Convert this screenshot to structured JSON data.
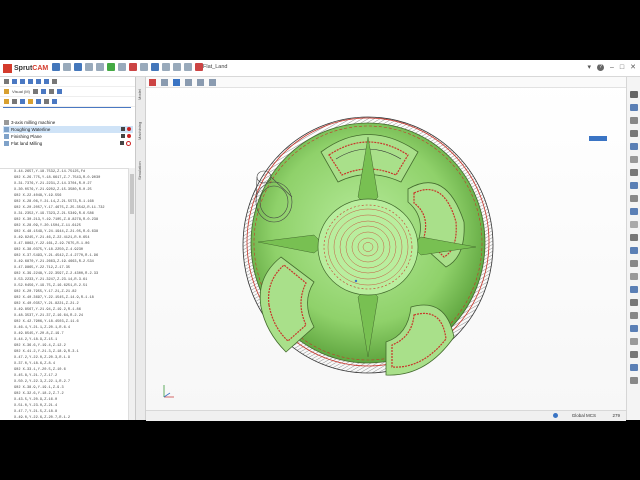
{
  "app": {
    "name_part1": "Sprut",
    "name_part2": "CAM",
    "document_title": "Flat_Land"
  },
  "left_panel": {
    "machine_select": "Visual (M)",
    "tree": [
      {
        "label": "3-axis milling machine",
        "selected": false,
        "checked": false,
        "status": "none"
      },
      {
        "label": "Roughing Waterline",
        "selected": true,
        "checked": true,
        "status": "filled"
      },
      {
        "label": "Finishing Plane",
        "selected": false,
        "checked": true,
        "status": "filled"
      },
      {
        "label": "Flat land Milling",
        "selected": false,
        "checked": true,
        "status": "hollow"
      }
    ],
    "code_lines": [
      "X-44.2657,Y-18.7532,Z-14.75125,Fd",
      "G02 X-26.775,Y-18.6617,Z-7.7543,R-0.9030",
      "X-31.7376,Y-21.2231,Z-14.3704,R-0.27",
      "X-30.0576,Y-21.9202,Z-15.3580,R-0.25",
      "G02 X-22.4048,Y-19.556",
      "G02 X-28.06,Y-21.14,Z-21.5573,R-1.168",
      "G02 X-20.2057,Y-17.4675,Z-25.3542,R-11.732",
      "X-31.2352,Y-19.7323,Z-21.5349,R-6.586",
      "G02 X-30.213,Y-19.7105,Z-8.8278,R-0.238",
      "G02 X-28.09,Y-20.1504,Z-11.6125",
      "G02 X-48.1549,Y-24.1944,Z-21.05,R-6.638",
      "X-49.8245,Y-21.46,Z-22.4121,R-0.654",
      "X-47.8862,Y-22.161,Z-19.7675,R-1.06",
      "G02 X-38.0375,Y-18.2250,Z-4.9230",
      "G02 X-37.5493,Y-21.4542,Z-4.2770,R-1.96",
      "X-49.6870,Y-21.2663,Z-19.4663,R-2.534",
      "X-47.9865,Y-22.712,Z-17.35",
      "G02 X-39.2248,Y-22.3597,Z-2.4300,R-2.33",
      "X-53.2233,Y-21.3247,Z-23.14,R-3.61",
      "X-52.0456,Y-19.75,Z-16.6251,R-2.51",
      "G02 X-20.7955,Y-17.21,Z-21.82",
      "G02 X-40.3697,Y-22.1545,Z-14.9,R-1.18",
      "G02 X-40.0357,Y-21.8221,Z-21.2",
      "X-49.8567,Y-21.94,Z-19.2,R-1.86",
      "X-48.3537,Y-21.37,Z-16.64,R-2.24",
      "G02 X-42.7906,Y-18.4503,Z-11.6",
      "X-46.4,Y-21.1,Z-20.1,R-6.4",
      "X-49.8545,Y-20.8,Z-19.7",
      "X-44.2,Y-18.9,Z-15.1",
      "G02 X-36.6,Y-19.4,Z-12.2",
      "G02 X-41.2,Y-21.3,Z-18.9,R-3.1",
      "X-47.2,Y-22.0,Z-20.3,R-1.9",
      "X-37.0,Y-18.6,Z-8.4",
      "G02 X-33.1,Y-20.5,Z-10.6",
      "X-45.8,Y-21.7,Z-17.2",
      "X-50.2,Y-22.3,Z-22.1,R-2.7",
      "G02 X-38.9,Y-19.1,Z-9.3",
      "G02 X-32.6,Y-18.2,Z-7.2",
      "X-43.5,Y-20.9,Z-16.0",
      "X-51.0,Y-23.0,Z-21.4",
      "X-47.7,Y-21.5,Z-18.8",
      "X-49.0,Y-22.6,Z-20.7,R-1.2"
    ]
  },
  "side_tabs": [
    "Model",
    "Machining",
    "Simulation"
  ],
  "viewport": {
    "axis_z": "Z",
    "axis_x": "X",
    "axis_y": "Y"
  },
  "status": {
    "coordinate_system": "Global MCS",
    "zoom": "279"
  },
  "colors": {
    "accent": "#d43b2c",
    "part_green": "#8fd16a",
    "toolpath_red": "#c8352a",
    "toolpath_black": "#333333",
    "selection_blue": "#cfe3f7"
  }
}
